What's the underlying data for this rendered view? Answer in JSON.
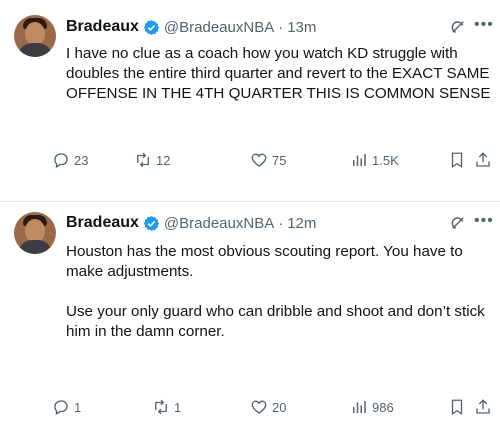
{
  "tweets": [
    {
      "display_name": "Bradeaux",
      "handle": "@BradeauxNBA",
      "time": "13m",
      "text_lines": [
        "I have no clue as a coach how you watch KD struggle with doubles the entire third quarter and revert to the EXACT SAME OFFENSE IN THE 4TH QUARTER THIS IS COMMON SENSE"
      ],
      "replies": "23",
      "retweets": "12",
      "likes": "75",
      "views": "1.5K"
    },
    {
      "display_name": "Bradeaux",
      "handle": "@BradeauxNBA",
      "time": "12m",
      "text_lines": [
        "Houston has the most obvious scouting report. You have to make adjustments.",
        "Use your only guard who can dribble and shoot and don’t stick him in the damn corner."
      ],
      "replies": "1",
      "retweets": "1",
      "likes": "20",
      "views": "986"
    }
  ],
  "colors": {
    "text": "#0f1419",
    "secondary": "#536471",
    "verified": "#1d9bf0",
    "divider": "#e6e9ec"
  },
  "icons": [
    "verified-badge-icon",
    "grok-icon",
    "more-icon",
    "reply-icon",
    "retweet-icon",
    "like-icon",
    "views-icon",
    "bookmark-icon",
    "share-icon"
  ]
}
